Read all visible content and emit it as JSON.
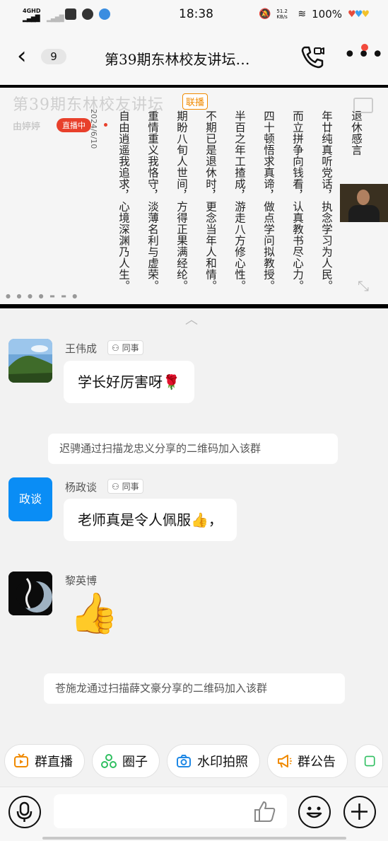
{
  "status_bar": {
    "network": "4GHD",
    "time": "18:38",
    "speed": "51.2 KB/s",
    "battery": "100%"
  },
  "header": {
    "badge_count": "9",
    "title": "第39期东林校友讲坛…"
  },
  "live": {
    "slide_title": "第39期东林校友讲坛",
    "tag": "联播",
    "host": "由婷婷",
    "status": "直播中",
    "date": "2024/6/10",
    "lines": [
      "退休感言",
      "年廿纯真听党话，执念学习为人民。",
      "而立拼争向钱看，认真教书尽心力。",
      "四十顿悟求真谛，做点学问拟教授。",
      "半百之年工揸成，游走八方修心性。",
      "不期已是退休时，更念当年人和情。",
      "期盼八旬人世间，方得正果满经纶。",
      "重情重义我恪守，淡薄名利与虚荣。",
      "自由逍遥我追求，心境深渊乃人生。"
    ]
  },
  "messages": [
    {
      "type": "chat",
      "name": "王伟成",
      "tag": "同事",
      "text": "学长好厉害呀🌹"
    },
    {
      "type": "system",
      "text": "迟骋通过扫描龙忠义分享的二维码加入该群"
    },
    {
      "type": "chat",
      "name": "杨政谈",
      "tag": "同事",
      "avatar_text": "政谈",
      "text": "老师真是令人佩服👍，"
    },
    {
      "type": "chat",
      "name": "黎英博",
      "text": "👍"
    },
    {
      "type": "system",
      "text": "苍施龙通过扫描薛文豪分享的二维码加入该群"
    }
  ],
  "quick_actions": [
    {
      "label": "群直播",
      "icon": "tv-icon",
      "color": "#f08a00"
    },
    {
      "label": "圈子",
      "icon": "circle-icon",
      "color": "#2fbf60"
    },
    {
      "label": "水印拍照",
      "icon": "camera-icon",
      "color": "#1e88e5"
    },
    {
      "label": "群公告",
      "icon": "megaphone-icon",
      "color": "#f08a00"
    }
  ],
  "colors": {
    "accent_blue": "#0a8df5",
    "live_red": "#e8402b",
    "tag_orange": "#f08a00"
  }
}
